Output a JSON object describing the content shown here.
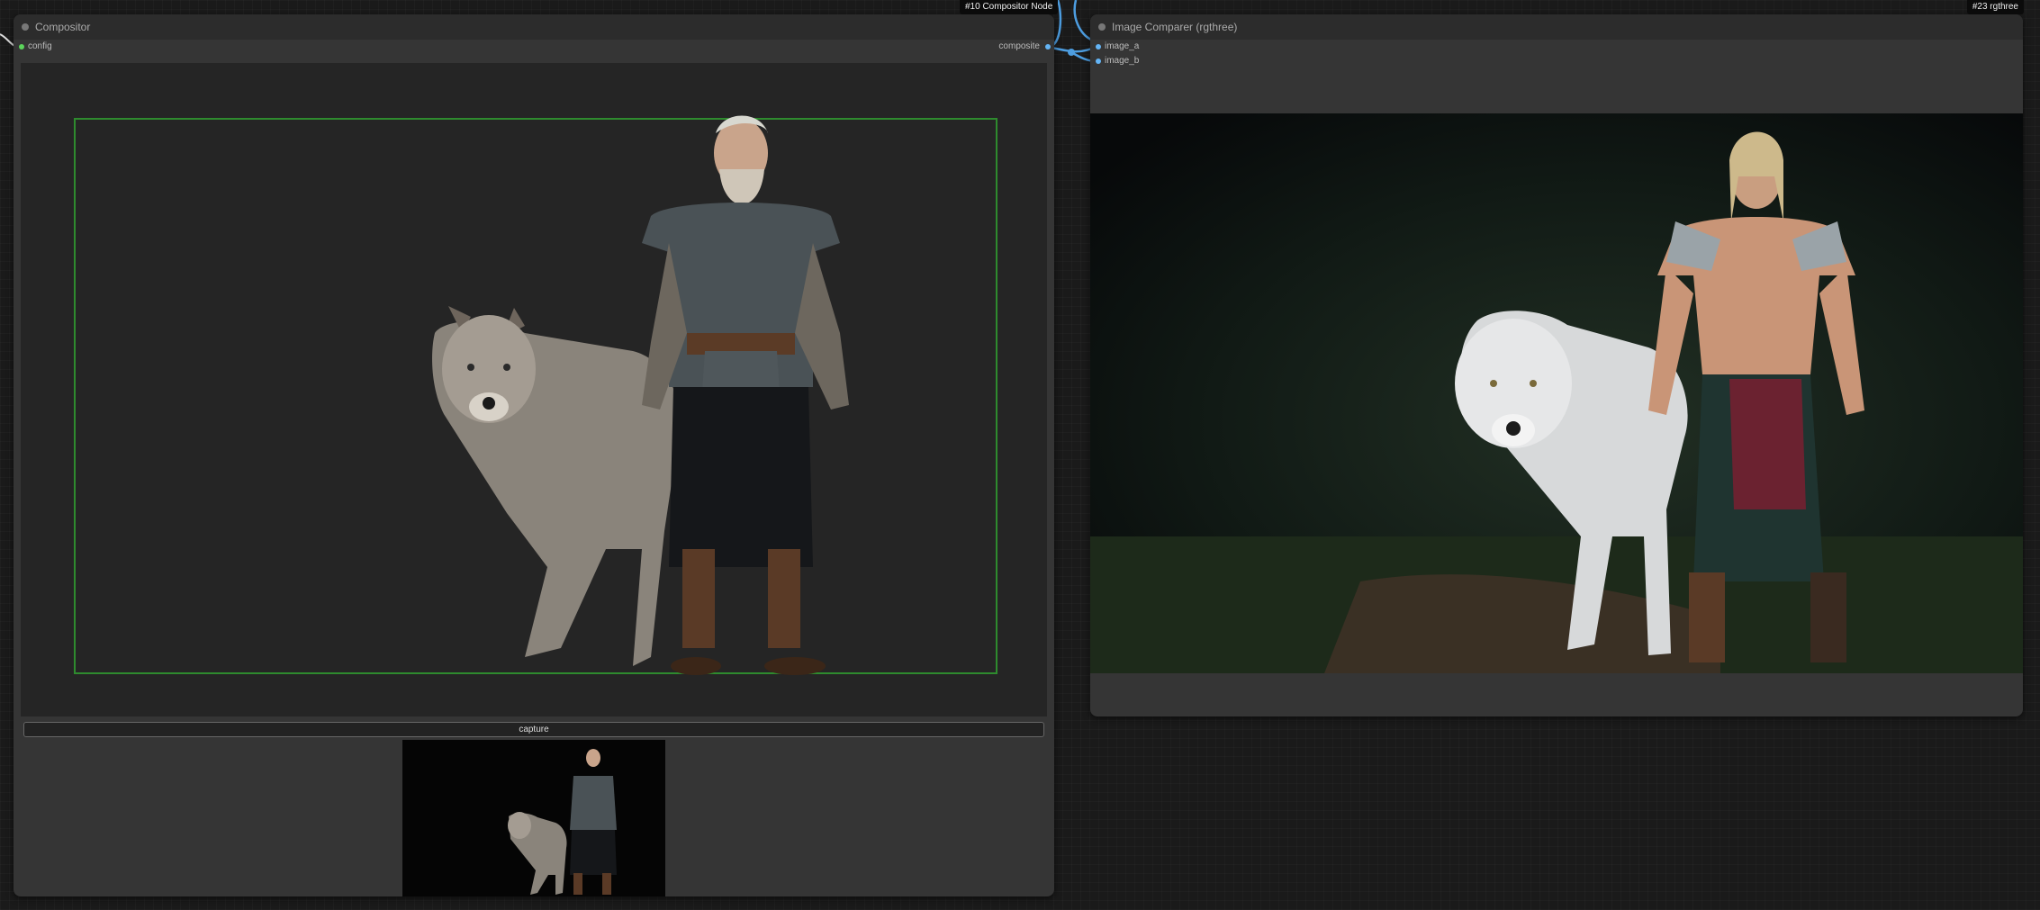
{
  "compositor": {
    "title": "Compositor",
    "badge": "#10 Compositor Node",
    "input_config": "config",
    "output_composite": "composite",
    "capture_label": "capture"
  },
  "comparer": {
    "title": "Image Comparer (rgthree)",
    "badge": "#23 rgthree",
    "input_a": "image_a",
    "input_b": "image_b"
  },
  "colors": {
    "config_slot": "#5bd45b",
    "image_slot": "#64b5f6",
    "wire": "#4d9de0",
    "canvas_border": "#2e8b2e"
  },
  "icons": [
    "node-collapse-dot-icon",
    "node-collapse-dot-icon"
  ]
}
